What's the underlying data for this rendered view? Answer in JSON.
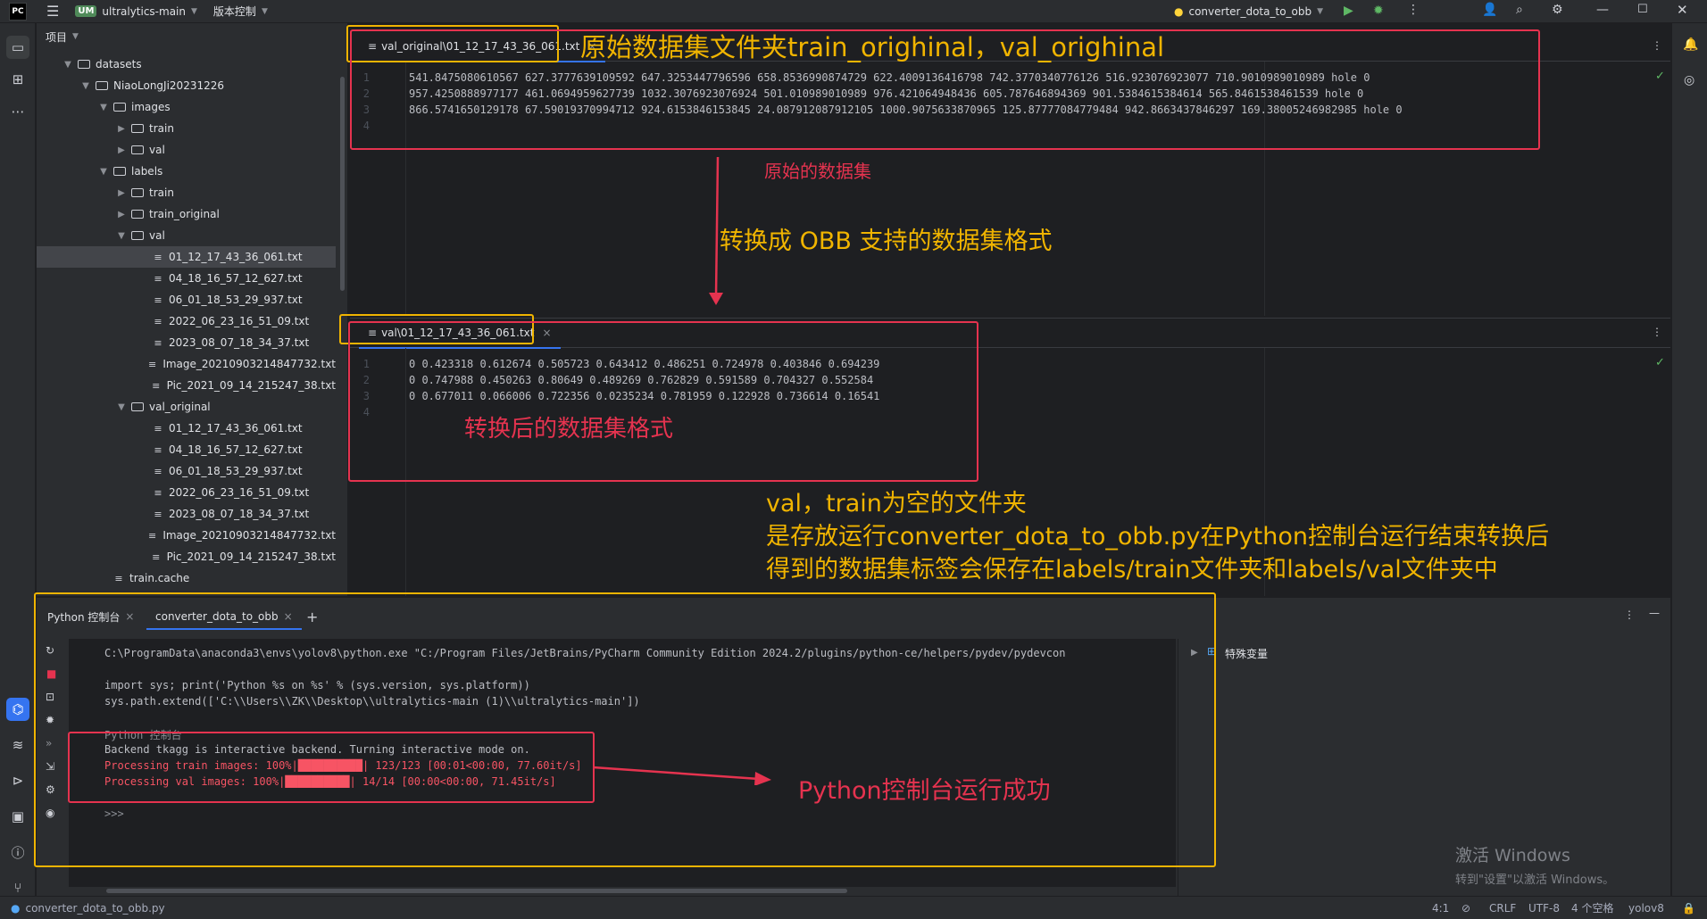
{
  "titlebar": {
    "app_badge": "UM",
    "project_name": "ultralytics-main",
    "vcs_menu": "版本控制",
    "run_config": "converter_dota_to_obb"
  },
  "project_panel": {
    "title": "项目",
    "tree": [
      {
        "label": "datasets",
        "type": "folder",
        "depth": 1,
        "expanded": true
      },
      {
        "label": "NiaoLongJi20231226",
        "type": "folder",
        "depth": 2,
        "expanded": true
      },
      {
        "label": "images",
        "type": "folder",
        "depth": 3,
        "expanded": true
      },
      {
        "label": "train",
        "type": "folder",
        "depth": 4,
        "expanded": false
      },
      {
        "label": "val",
        "type": "folder",
        "depth": 4,
        "expanded": false
      },
      {
        "label": "labels",
        "type": "folder",
        "depth": 3,
        "expanded": true
      },
      {
        "label": "train",
        "type": "folder",
        "depth": 4,
        "expanded": false
      },
      {
        "label": "train_original",
        "type": "folder",
        "depth": 4,
        "expanded": false
      },
      {
        "label": "val",
        "type": "folder",
        "depth": 4,
        "expanded": true
      },
      {
        "label": "01_12_17_43_36_061.txt",
        "type": "file",
        "depth": 5,
        "selected": true
      },
      {
        "label": "04_18_16_57_12_627.txt",
        "type": "file",
        "depth": 5
      },
      {
        "label": "06_01_18_53_29_937.txt",
        "type": "file",
        "depth": 5
      },
      {
        "label": "2022_06_23_16_51_09.txt",
        "type": "file",
        "depth": 5
      },
      {
        "label": "2023_08_07_18_34_37.txt",
        "type": "file",
        "depth": 5
      },
      {
        "label": "Image_20210903214847732.txt",
        "type": "file",
        "depth": 5
      },
      {
        "label": "Pic_2021_09_14_215247_38.txt",
        "type": "file",
        "depth": 5
      },
      {
        "label": "val_original",
        "type": "folder",
        "depth": 4,
        "expanded": true
      },
      {
        "label": "01_12_17_43_36_061.txt",
        "type": "file",
        "depth": 5
      },
      {
        "label": "04_18_16_57_12_627.txt",
        "type": "file",
        "depth": 5
      },
      {
        "label": "06_01_18_53_29_937.txt",
        "type": "file",
        "depth": 5
      },
      {
        "label": "2022_06_23_16_51_09.txt",
        "type": "file",
        "depth": 5
      },
      {
        "label": "2023_08_07_18_34_37.txt",
        "type": "file",
        "depth": 5
      },
      {
        "label": "Image_20210903214847732.txt",
        "type": "file",
        "depth": 5
      },
      {
        "label": "Pic_2021_09_14_215247_38.txt",
        "type": "file",
        "depth": 5
      },
      {
        "label": "train.cache",
        "type": "file",
        "depth": 3
      }
    ]
  },
  "editor_top": {
    "tab_label": "val_original\\01_12_17_43_36_061.txt",
    "line_numbers": [
      "1",
      "2",
      "3",
      "4"
    ],
    "lines": [
      "541.8475080610567 627.3777639109592 647.3253447796596 658.8536990874729 622.4009136416798 742.3770340776126 516.923076923077 710.9010989010989 hole 0",
      "957.4250888977177 461.0694959627739 1032.3076923076924 501.010989010989 976.421064948436 605.787646894369 901.5384615384614 565.8461538461539 hole 0",
      "866.5741650129178 67.59019370994712 924.6153846153845 24.087912087912105 1000.9075633870965 125.87777084779484 942.8663437846297 169.38005246982985 hole 0",
      ""
    ]
  },
  "editor_bottom": {
    "tab_label": "val\\01_12_17_43_36_061.txt",
    "line_numbers": [
      "1",
      "2",
      "3",
      "4"
    ],
    "lines": [
      "0 0.423318 0.612674 0.505723 0.643412 0.486251 0.724978 0.403846 0.694239",
      "0 0.747988 0.450263 0.80649 0.489269 0.762829 0.591589 0.704327 0.552584",
      "0 0.677011 0.066006 0.722356 0.0235234 0.781959 0.122928 0.736614 0.16541",
      ""
    ]
  },
  "annotations": {
    "top_title": "原始数据集文件夹train_orighinal，val_orighinal",
    "original_label": "原始的数据集",
    "convert_label": "转换成 OBB 支持的数据集格式",
    "converted_label": "转换后的数据集格式",
    "note_lines": [
      "val，train为空的文件夹",
      "是存放运行converter_dota_to_obb.py在Python控制台运行结束转换后",
      "得到的数据集标签会保存在labels/train文件夹和labels/val文件夹中"
    ],
    "console_label": "Python控制台运行成功"
  },
  "console": {
    "tabs": [
      "Python 控制台",
      "converter_dota_to_obb"
    ],
    "lines": [
      {
        "text": "C:\\ProgramData\\anaconda3\\envs\\yolov8\\python.exe \"C:/Program Files/JetBrains/PyCharm Community Edition 2024.2/plugins/python-ce/helpers/pydev/pydevcon",
        "color": "#bcbec4"
      },
      {
        "text": "",
        "color": "#bcbec4"
      },
      {
        "text": "import sys; print('Python %s on %s' % (sys.version, sys.platform))",
        "color": "#bcbec4"
      },
      {
        "text": "sys.path.extend(['C:\\\\Users\\\\ZK\\\\Desktop\\\\ultralytics-main (1)\\\\ultralytics-main'])",
        "color": "#bcbec4"
      },
      {
        "text": "",
        "color": "#bcbec4"
      },
      {
        "text": "Python 控制台",
        "color": "#8c8f95"
      },
      {
        "text": "Backend tkagg is interactive backend. Turning interactive mode on.",
        "color": "#bcbec4"
      },
      {
        "text": "Processing train images: 100%|██████████| 123/123 [00:01<00:00, 77.60it/s]",
        "color": "#f75464"
      },
      {
        "text": "Processing val images: 100%|██████████| 14/14 [00:00<00:00, 71.45it/s]",
        "color": "#f75464"
      },
      {
        "text": "",
        "color": "#bcbec4"
      },
      {
        "text": ">>>",
        "color": "#8c8f95"
      }
    ],
    "variables_label": "特殊变量"
  },
  "watermark": {
    "line1": "激活 Windows",
    "line2": "转到\"设置\"以激活 Windows。"
  },
  "statusbar": {
    "file": "converter_dota_to_obb.py",
    "position": "4:1",
    "line_ending": "CRLF",
    "encoding": "UTF-8",
    "indent": "4 个空格",
    "interpreter": "yolov8"
  },
  "colors": {
    "annotation_red": "#e5334f",
    "annotation_yellow": "#f0b400",
    "accent_blue": "#3574f0"
  }
}
